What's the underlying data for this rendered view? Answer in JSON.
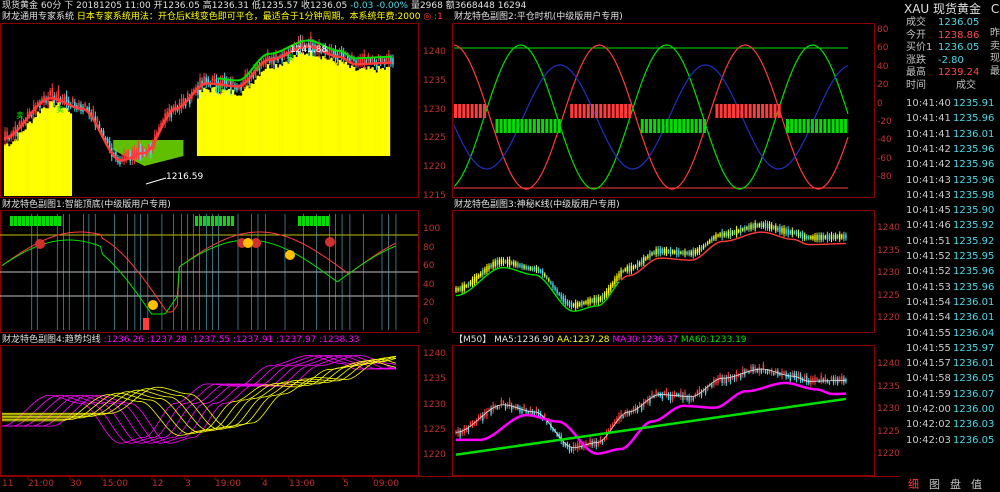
{
  "top_info": {
    "symbol": "现货黄金",
    "period": "60分",
    "arrow": "下",
    "date": "20181205",
    "time": "11:00",
    "open_label": "开",
    "open": "1236.05",
    "high_label": "高",
    "high": "1236.31",
    "low_label": "低",
    "low": "1235.57",
    "close_label": "收",
    "close": "1236.05",
    "change": "-0.03",
    "pct": "-0.00%",
    "vol_label": "量",
    "vol": "2968",
    "amt_label": "额",
    "amt": "3668448",
    "extra": "16294"
  },
  "main_panel": {
    "title": "财龙通用专家系统",
    "note": "日本专家系统用法：开仓后K线变色即可平仓，最适合于1分钟周期。本系统年费:2000",
    "note_suffix": "◎ :1",
    "high_mark": "1241.88",
    "low_mark": "1216.59",
    "sell_label": "卖",
    "yticks": [
      "1240",
      "1235",
      "1230",
      "1225",
      "1220",
      "1215"
    ]
  },
  "sub1": {
    "title": "财龙特色副图1:智能顶底(中级版用户专用)",
    "yticks": [
      "100",
      "80",
      "60",
      "40",
      "20",
      "0"
    ]
  },
  "sub2": {
    "title": "财龙特色副图2:平仓时机(中级版用户专用)",
    "yticks": [
      "80",
      "60",
      "40",
      "20",
      "0",
      "-20",
      "-40",
      "-60",
      "-80"
    ]
  },
  "sub3": {
    "title": "财龙特色副图3:神秘K线(中级版用户专用)",
    "yticks": [
      "1240",
      "1235",
      "1230",
      "1225",
      "1220"
    ]
  },
  "sub4": {
    "title": "财龙特色副图4:趋势均线",
    "values": [
      ":1236.26",
      ":1237.28",
      ":1237.55",
      ":1237.91",
      ":1237.97",
      ":1238.33"
    ],
    "yticks": [
      "1240",
      "1235",
      "1230",
      "1225",
      "1220"
    ]
  },
  "ma_panel": {
    "title": "【M50】",
    "ma5": "MA5:1236.90",
    "aa": "AA:1237.28",
    "ma30": "MA30:1236.37",
    "ma60": "MA60:1233.19",
    "yticks": [
      "1240",
      "1235",
      "1230",
      "1225",
      "1220"
    ]
  },
  "time_axis": [
    "11",
    "21:00",
    "30",
    "15:00",
    "12",
    "3",
    "19:00",
    "4",
    "13:00",
    "5",
    "09:00"
  ],
  "quote": {
    "code": "XAU",
    "name": "现货黄金",
    "extra": "C",
    "rows": [
      {
        "k": "成交",
        "v": "1236.05",
        "c": "#4fd7e6"
      },
      {
        "k": "今开",
        "v": "1238.86",
        "c": "#ff4b4b"
      },
      {
        "k": "买价1",
        "v": "1236.05",
        "c": "#4fd7e6"
      },
      {
        "k": "涨跌",
        "v": "-2.80",
        "c": "#4fd7e6"
      },
      {
        "k": "最高",
        "v": "1239.24",
        "c": "#ff4b4b"
      }
    ],
    "right_col": [
      "昨",
      "卖",
      "现",
      "最"
    ],
    "ticks_header_time": "时间",
    "ticks_header_price": "成交",
    "ticks": [
      {
        "t": "10:41:40",
        "p": "1235.91"
      },
      {
        "t": "10:41:41",
        "p": "1235.96"
      },
      {
        "t": "10:41:41",
        "p": "1236.01"
      },
      {
        "t": "10:41:42",
        "p": "1235.96"
      },
      {
        "t": "10:41:42",
        "p": "1235.96"
      },
      {
        "t": "10:41:43",
        "p": "1235.96"
      },
      {
        "t": "10:41:43",
        "p": "1235.98"
      },
      {
        "t": "10:41:45",
        "p": "1235.90"
      },
      {
        "t": "10:41:46",
        "p": "1235.92"
      },
      {
        "t": "10:41:51",
        "p": "1235.92"
      },
      {
        "t": "10:41:52",
        "p": "1235.95"
      },
      {
        "t": "10:41:52",
        "p": "1235.96"
      },
      {
        "t": "10:41:53",
        "p": "1235.96"
      },
      {
        "t": "10:41:54",
        "p": "1236.01"
      },
      {
        "t": "10:41:54",
        "p": "1236.01"
      },
      {
        "t": "10:41:55",
        "p": "1236.04"
      },
      {
        "t": "10:41:55",
        "p": "1235.97"
      },
      {
        "t": "10:41:57",
        "p": "1236.01"
      },
      {
        "t": "10:41:58",
        "p": "1236.05"
      },
      {
        "t": "10:41:59",
        "p": "1236.07"
      },
      {
        "t": "10:42:00",
        "p": "1236.00"
      },
      {
        "t": "10:42:02",
        "p": "1236.03"
      },
      {
        "t": "10:42:03",
        "p": "1236.05"
      }
    ],
    "tabs": [
      "细",
      "图",
      "盘",
      "值"
    ]
  },
  "colors": {
    "up": "#ff3b3b",
    "down": "#4fd7e6",
    "grid": "#7a0000",
    "yellow": "#ffff00",
    "green": "#00e000",
    "magenta": "#ff00ff"
  }
}
